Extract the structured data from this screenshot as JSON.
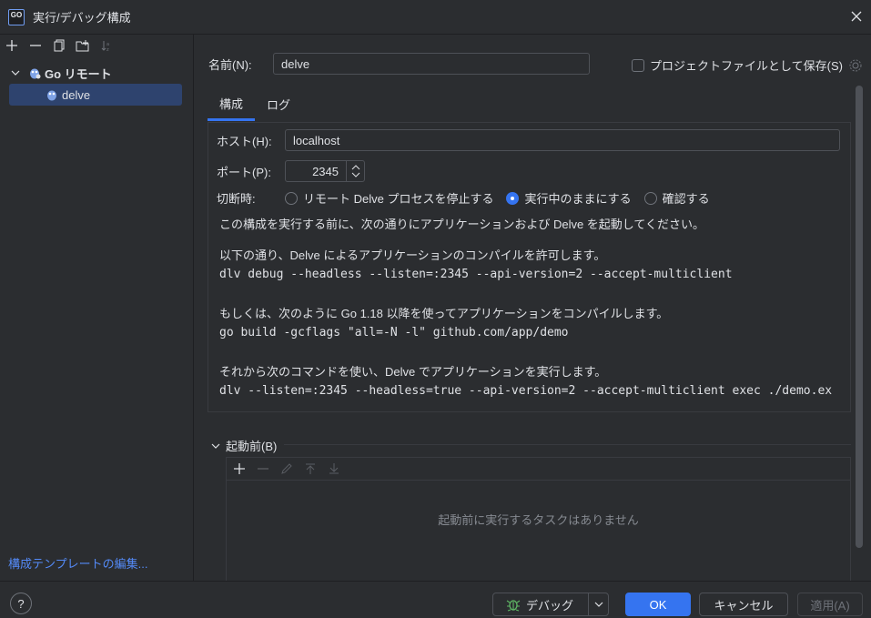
{
  "window": {
    "title": "実行/デバッグ構成",
    "app_icon_text": "GO"
  },
  "sidebar": {
    "group_label": "Go リモート",
    "child_label": "delve",
    "template_link": "構成テンプレートの編集..."
  },
  "form": {
    "name_label": "名前(N):",
    "name_value": "delve",
    "save_project_label": "プロジェクトファイルとして保存(S)",
    "tabs": [
      "構成",
      "ログ"
    ],
    "host_label": "ホスト(H):",
    "host_value": "localhost",
    "port_label": "ポート(P):",
    "port_value": "2345",
    "disconnect_label": "切断時:",
    "radio_options": [
      "リモート Delve プロセスを停止する",
      "実行中のままにする",
      "確認する"
    ],
    "selected_radio": 1
  },
  "instructions": {
    "intro": "この構成を実行する前に、次の通りにアプリケーションおよび Delve を起動してください。",
    "step1_text": "以下の通り、Delve によるアプリケーションのコンパイルを許可します。",
    "step1_cmd": "dlv debug --headless --listen=:2345 --api-version=2 --accept-multiclient",
    "step2_text": "もしくは、次のように Go 1.18 以降を使ってアプリケーションをコンパイルします。",
    "step2_cmd": "go build -gcflags \"all=-N -l\" github.com/app/demo",
    "step3_text": "それから次のコマンドを使い、Delve でアプリケーションを実行します。",
    "step3_cmd": "dlv --listen=:2345 --headless=true --api-version=2 --accept-multiclient exec ./demo.ex"
  },
  "before_launch": {
    "label": "起動前(B)",
    "empty_text": "起動前に実行するタスクはありません"
  },
  "buttons": {
    "help": "?",
    "debug": "デバッグ",
    "ok": "OK",
    "cancel": "キャンセル",
    "apply": "適用(A)"
  },
  "colors": {
    "accent": "#3574f0",
    "link": "#548af7",
    "background": "#2b2d30"
  }
}
